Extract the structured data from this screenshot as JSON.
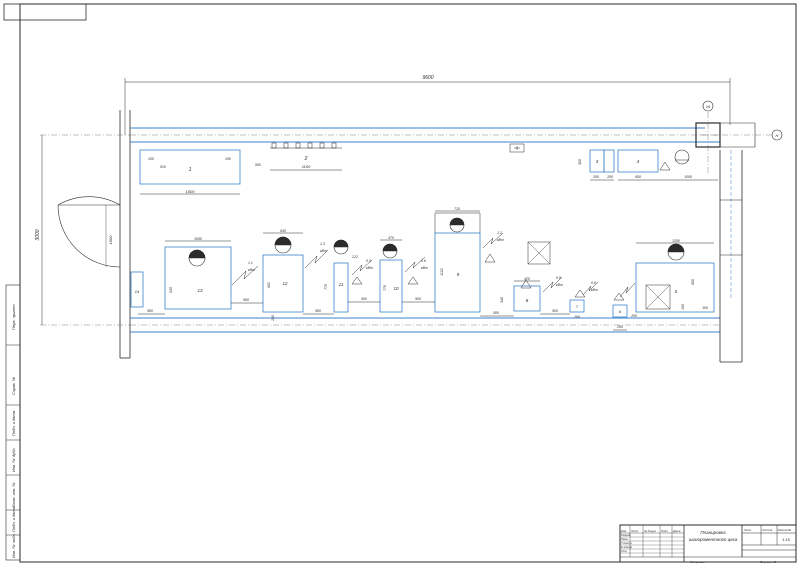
{
  "drawing": {
    "overall_dimension": "9600",
    "room_height_dimension": "3000",
    "door_dimension": "1000",
    "axis_labels": [
      "16",
      "Н"
    ]
  },
  "equipment": [
    {
      "number": "1",
      "width": "1600",
      "extra": [
        "100",
        "510",
        "100"
      ]
    },
    {
      "number": "2",
      "width": "1100"
    },
    {
      "number": "3",
      "width": "200"
    },
    {
      "number": "4",
      "width": "650"
    },
    {
      "number": "5",
      "width": "1200",
      "height": "800"
    },
    {
      "number": "6"
    },
    {
      "number": "7",
      "width": "200",
      "power": "0.6",
      "power_unit": "кВт"
    },
    {
      "number": "8",
      "width": "420",
      "height": "340",
      "power": "0.9",
      "power_unit": "кВт"
    },
    {
      "number": "9",
      "width": "715",
      "height": "1162",
      "power": "1.2",
      "power_unit": "кВт"
    },
    {
      "number": "10",
      "width": "370",
      "height": "770",
      "power": "0.6",
      "power_unit": "кВт"
    },
    {
      "number": "11",
      "width": "212",
      "height": "770",
      "power": "0.3",
      "power_unit": "кВт"
    },
    {
      "number": "12",
      "width": "640",
      "height": "862",
      "power": "1.3",
      "power_unit": "кВт"
    },
    {
      "number": "13",
      "width": "1050",
      "height": "645",
      "power": "1.1",
      "power_unit": "кВт"
    },
    {
      "number": "14"
    }
  ],
  "gap_dimensions": [
    "500",
    "500",
    "500",
    "500",
    "500",
    "500",
    "500",
    "200",
    "200",
    "1000",
    "100",
    "100",
    "260",
    "280",
    "300"
  ],
  "title_block": {
    "title_line1": "Планировка",
    "title_line2": "шинороментного цеха",
    "sheet_label": "Лист",
    "sheets_label": "Листов",
    "scale_label": "Масштаб",
    "scale": "1:15",
    "format": "Формат А1",
    "copied": "Копировал",
    "rows": [
      "Изм.",
      "Разраб.",
      "Пров.",
      "Т.контр.",
      "Н.контр.",
      "Утв."
    ],
    "cols": [
      "Лист",
      "№ докум.",
      "Подп.",
      "Дата"
    ]
  },
  "side_stamp": [
    "Перв. примен.",
    "Справ. №",
    "Подп. и дата",
    "Инв. № дубл.",
    "Взам. инв. №",
    "Подп. и дата",
    "Инв. № подл."
  ]
}
